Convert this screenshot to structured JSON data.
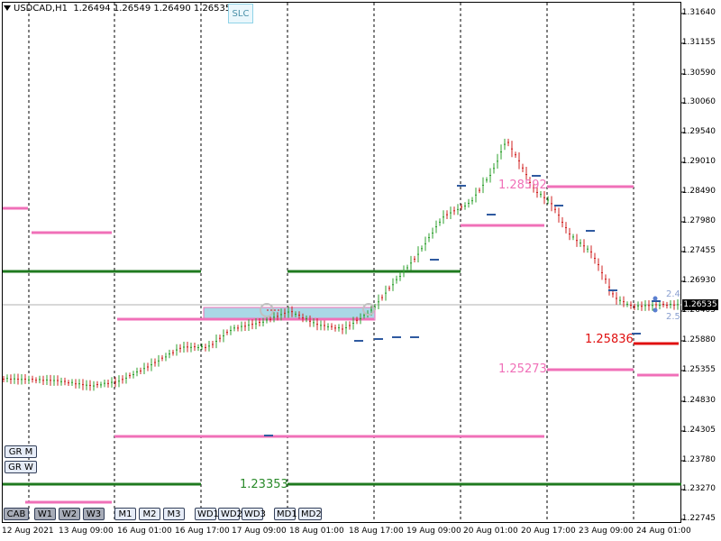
{
  "header": {
    "symbol": "USDCAD,H1",
    "ohlc": "1.26494 1.26549 1.26490 1.26535"
  },
  "slc_button_label": "SLC",
  "current_price": "1.26535",
  "price_axis": [
    "1.31640",
    "1.31155",
    "1.30590",
    "1.30060",
    "1.29540",
    "1.29010",
    "1.28490",
    "1.27980",
    "1.27455",
    "1.26930",
    "1.26405",
    "1.25880",
    "1.25355",
    "1.24830",
    "1.24305",
    "1.23780",
    "1.23270",
    "1.22745"
  ],
  "time_axis": [
    "12 Aug 2021",
    "13 Aug 09:00",
    "16 Aug 01:00",
    "16 Aug 17:00",
    "17 Aug 09:00",
    "18 Aug 01:00",
    "18 Aug 17:00",
    "19 Aug 09:00",
    "20 Aug 01:00",
    "20 Aug 17:00",
    "23 Aug 09:00",
    "24 Aug 01:00"
  ],
  "level_labels": [
    {
      "text": "1.23353",
      "color": "#2a8a2a"
    },
    {
      "text": "1.25836",
      "color": "#e01010"
    },
    {
      "text": "1.25273",
      "color": "#f070b8"
    },
    {
      "text": "1.28592",
      "color": "#f070b8"
    }
  ],
  "side_markers": [
    "2.4",
    "2.5"
  ],
  "grid_buttons": {
    "gr_m": "GR M",
    "gr_w": "GR W"
  },
  "timeframe_buttons": [
    {
      "label": "CAB",
      "state": "dark"
    },
    {
      "label": "W1",
      "state": "dark"
    },
    {
      "label": "W2",
      "state": "dark"
    },
    {
      "label": "W3",
      "state": "dark"
    },
    {
      "label": "M1",
      "state": "light"
    },
    {
      "label": "M2",
      "state": "light"
    },
    {
      "label": "M3",
      "state": "light"
    },
    {
      "label": "WD1",
      "state": "light"
    },
    {
      "label": "WD2",
      "state": "light"
    },
    {
      "label": "WD3",
      "state": "light"
    },
    {
      "label": "MD1",
      "state": "light"
    },
    {
      "label": "MD2",
      "state": "light"
    }
  ],
  "colors": {
    "pink_level": "#f070b8",
    "green_level": "#1f7a1f",
    "red_level": "#e01010",
    "bull_candle": "#2ea02e",
    "bear_candle": "#d02020",
    "blue_marks": "#2f5aa0",
    "highlight_box": "#aad8e6"
  }
}
